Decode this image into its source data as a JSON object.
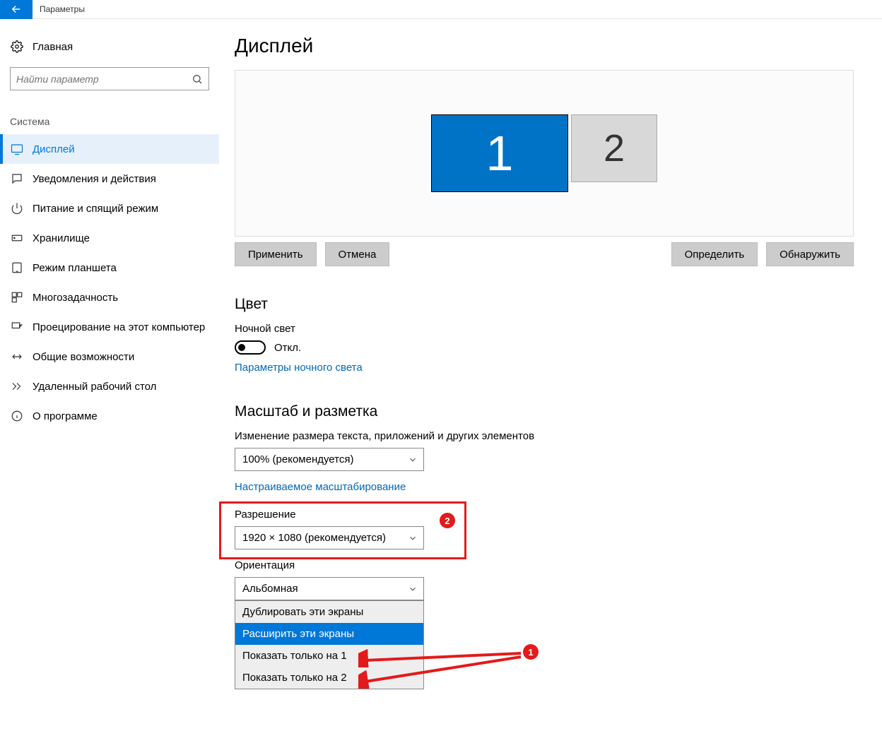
{
  "header": {
    "title": "Параметры"
  },
  "sidebar": {
    "home": "Главная",
    "search_placeholder": "Найти параметр",
    "section": "Система",
    "items": [
      {
        "label": "Дисплей",
        "icon": "display",
        "active": true
      },
      {
        "label": "Уведомления и действия",
        "icon": "notification"
      },
      {
        "label": "Питание и спящий режим",
        "icon": "power"
      },
      {
        "label": "Хранилище",
        "icon": "storage"
      },
      {
        "label": "Режим планшета",
        "icon": "tablet"
      },
      {
        "label": "Многозадачность",
        "icon": "multitask"
      },
      {
        "label": "Проецирование на этот компьютер",
        "icon": "project"
      },
      {
        "label": "Общие возможности",
        "icon": "share"
      },
      {
        "label": "Удаленный рабочий стол",
        "icon": "remote"
      },
      {
        "label": "О программе",
        "icon": "about"
      }
    ]
  },
  "main": {
    "title": "Дисплей",
    "monitor1": "1",
    "monitor2": "2",
    "btn_apply": "Применить",
    "btn_cancel": "Отмена",
    "btn_identify": "Определить",
    "btn_detect": "Обнаружить",
    "color_h": "Цвет",
    "nightlight_label": "Ночной свет",
    "toggle_state": "Откл.",
    "nightlight_link": "Параметры ночного света",
    "scale_h": "Масштаб и разметка",
    "scale_label": "Изменение размера текста, приложений и других элементов",
    "scale_value": "100% (рекомендуется)",
    "scale_link": "Настраиваемое масштабирование",
    "resolution_label": "Разрешение",
    "resolution_value": "1920 × 1080 (рекомендуется)",
    "orientation_label": "Ориентация",
    "orientation_value": "Альбомная",
    "dd_options": [
      "Дублировать эти экраны",
      "Расширить эти экраны",
      "Показать только на 1",
      "Показать только на 2"
    ],
    "badge1": "1",
    "badge2": "2"
  }
}
